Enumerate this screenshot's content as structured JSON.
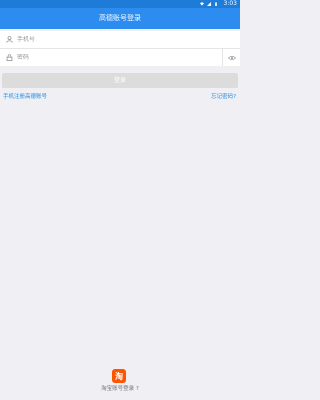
{
  "status_bar": {
    "time": "3:03",
    "bg_color": "#1e7bd8"
  },
  "header": {
    "title": "高德账号登录",
    "bg_color": "#2d8cf0"
  },
  "form": {
    "phone_placeholder": "手机号",
    "password_placeholder": "密码",
    "login_label": "登录"
  },
  "links": {
    "register": "手机注册高德账号",
    "forgot": "忘记密码?"
  },
  "footer": {
    "logo_char": "淘",
    "alt_login": "淘宝账号登录 ?"
  }
}
